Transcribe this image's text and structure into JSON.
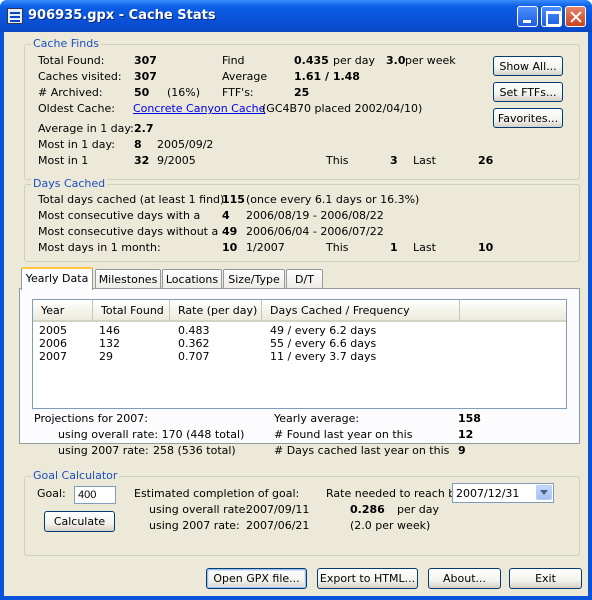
{
  "window": {
    "title": "906935.gpx - Cache Stats"
  },
  "cache_finds": {
    "title": "Cache Finds",
    "total_found_label": "Total Found:",
    "total_found": "307",
    "caches_visited_label": "Caches visited:",
    "caches_visited": "307",
    "archived_label": "# Archived:",
    "archived": "50",
    "archived_pct": "(16%)",
    "oldest_label": "Oldest Cache:",
    "oldest_link": "Concrete Canyon Cache",
    "oldest_detail": "(GC4B70 placed 2002/04/10)",
    "find_rate_label": "Find",
    "per_day_value": "0.435",
    "per_day_label": "per day",
    "per_week_value": "3.0",
    "per_week_label": "per week",
    "average_label": "Average",
    "average_value": "1.61 / 1.48",
    "ftfs_label": "FTF's:",
    "ftfs_value": "25",
    "avg_1day_label": "Average in 1 day:",
    "avg_1day": "2.7",
    "most_1day_label": "Most in 1 day:",
    "most_1day": "8",
    "most_1day_date": "2005/09/2",
    "most_in1_label": "Most in 1",
    "most_in1": "32",
    "most_in1_date": "9/2005",
    "this_label": "This",
    "this_value": "3",
    "last_label": "Last",
    "last_value": "26"
  },
  "days_cached": {
    "title": "Days Cached",
    "total_label": "Total days cached (at least 1 find):",
    "total_value": "115",
    "total_detail": "(once every 6.1 days or 16.3%)",
    "consec_with_label": "Most consecutive days with a",
    "consec_with": "4",
    "consec_with_range": "2006/08/19 - 2006/08/22",
    "consec_without_label": "Most consecutive days without a",
    "consec_without": "49",
    "consec_without_range": "2006/06/04 - 2006/07/22",
    "month_label": "Most days in 1 month:",
    "month_value": "10",
    "month_date": "1/2007",
    "this_label": "This",
    "this_value": "1",
    "last_label": "Last",
    "last_value": "10"
  },
  "tabs": [
    "Yearly Data",
    "Milestones",
    "Locations",
    "Size/Type",
    "D/T"
  ],
  "yearly": {
    "columns": [
      "Year",
      "Total Found",
      "Rate (per day)",
      "Days Cached / Frequency"
    ],
    "rows": [
      [
        "2005",
        "146",
        "0.483",
        "49 / every 6.2 days"
      ],
      [
        "2006",
        "132",
        "0.362",
        "55 / every 6.6 days"
      ],
      [
        "2007",
        "29",
        "0.707",
        "11 / every 3.7 days"
      ]
    ],
    "projections_label": "Projections for 2007:",
    "overall_rate_label": "using overall rate: 170 (448 total)",
    "rate2007_label": "using 2007 rate:",
    "rate2007_value": "258 (536 total)",
    "yearly_avg_label": "Yearly average:",
    "yearly_avg": "158",
    "found_last_label": "# Found last year on this",
    "found_last": "12",
    "days_last_label": "# Days cached last year on this",
    "days_last": "9"
  },
  "goal": {
    "title": "Goal Calculator",
    "goal_label": "Goal:",
    "goal_value": "400",
    "calculate_label": "Calculate",
    "estimated_label": "Estimated completion of goal:",
    "overall_label": "using overall rate:",
    "overall_date": "2007/09/11",
    "rate2007_label": "using 2007 rate:",
    "rate2007_date": "2007/06/21",
    "rate_needed_label": "Rate needed to reach by",
    "rate_needed_date": "2007/12/31",
    "per_day_value": "0.286",
    "per_day_label": "per day",
    "per_week": "(2.0 per week)"
  },
  "side_buttons": {
    "show_all": "Show All...",
    "set_ftfs": "Set FTFs...",
    "favorites": "Favorites..."
  },
  "bottom_buttons": {
    "open_gpx": "Open GPX file...",
    "export_html": "Export to HTML...",
    "about": "About...",
    "exit": "Exit"
  }
}
